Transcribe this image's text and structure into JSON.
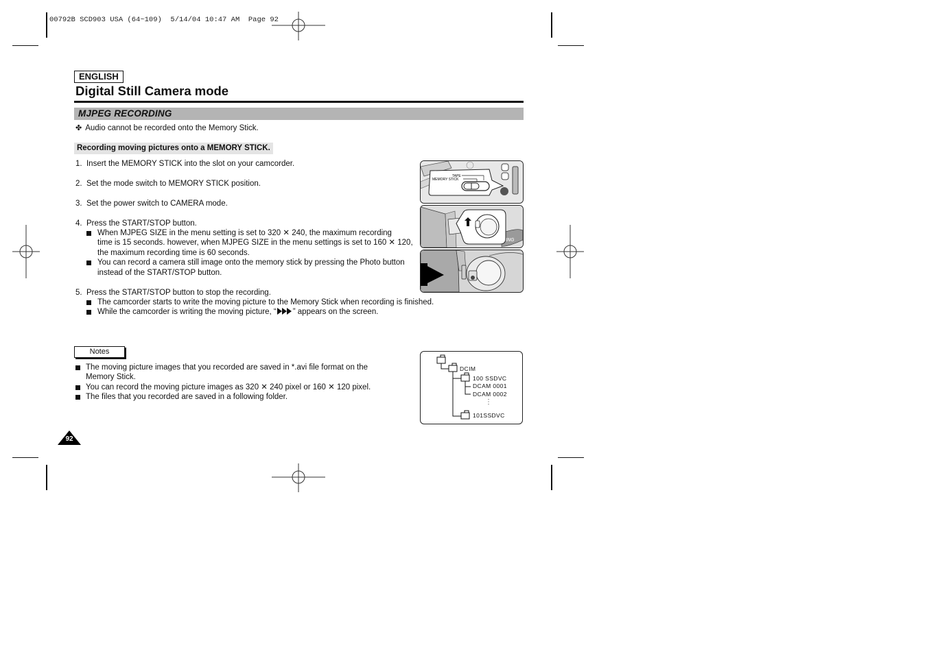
{
  "print_header": {
    "job_line": "00792B SCD903 USA (64~109)  5/14/04 10:47 AM  Page 92"
  },
  "header": {
    "language_tag": "ENGLISH",
    "title": "Digital Still Camera mode"
  },
  "section": {
    "title": "MJPEG RECORDING",
    "intro_symbol": "✤",
    "intro_note": "Audio cannot be recorded onto the Memory Stick."
  },
  "procedure": {
    "heading": "Recording moving pictures onto a MEMORY STICK.",
    "steps": [
      {
        "num": "1.",
        "text": "Insert the MEMORY STICK into the slot on your camcorder."
      },
      {
        "num": "2.",
        "text": "Set the mode switch to MEMORY STICK position."
      },
      {
        "num": "3.",
        "text": "Set the power switch to CAMERA mode."
      },
      {
        "num": "4.",
        "text": "Press the START/STOP button.",
        "bullets": [
          [
            "When MJPEG SIZE in the menu setting is set to 320 ✕ 240, the maximum recording",
            "time is 15 seconds. however, when MJPEG SIZE in the menu settings is set to 160 ✕ 120,",
            "the maximum recording time is 60 seconds."
          ],
          [
            "You can record a camera still image onto the memory stick by pressing the Photo button",
            "instead of the START/STOP button."
          ]
        ]
      },
      {
        "num": "5.",
        "text": "Press the START/STOP button to stop the recording.",
        "bullets": [
          [
            "The camcorder starts to write the moving picture to the Memory Stick when recording is finished."
          ],
          [
            "While the camcorder is writing the moving picture, “",
            "” appears on the screen."
          ]
        ]
      }
    ]
  },
  "figures": {
    "switch_labels": {
      "tape": "TAPE",
      "memory_stick": "MEMORY STICK"
    },
    "brand_fragment": "ING"
  },
  "notes": {
    "label": "Notes",
    "items": [
      [
        "The moving picture images that you recorded are saved in *.avi file format on the",
        "Memory Stick."
      ],
      [
        "You can record the moving picture images as 320 ✕ 240 pixel or 160 ✕ 120 pixel."
      ],
      [
        "The files that you recorded are saved in a following folder."
      ]
    ]
  },
  "folder_tree": {
    "root": "",
    "level1": "DCIM",
    "level2a": "100 SSDVC",
    "files": [
      "DCAM 0001",
      "DCAM 0002"
    ],
    "ellipsis": "⋮",
    "level2b": "101SSDVC"
  },
  "footer": {
    "page_number": "92"
  }
}
